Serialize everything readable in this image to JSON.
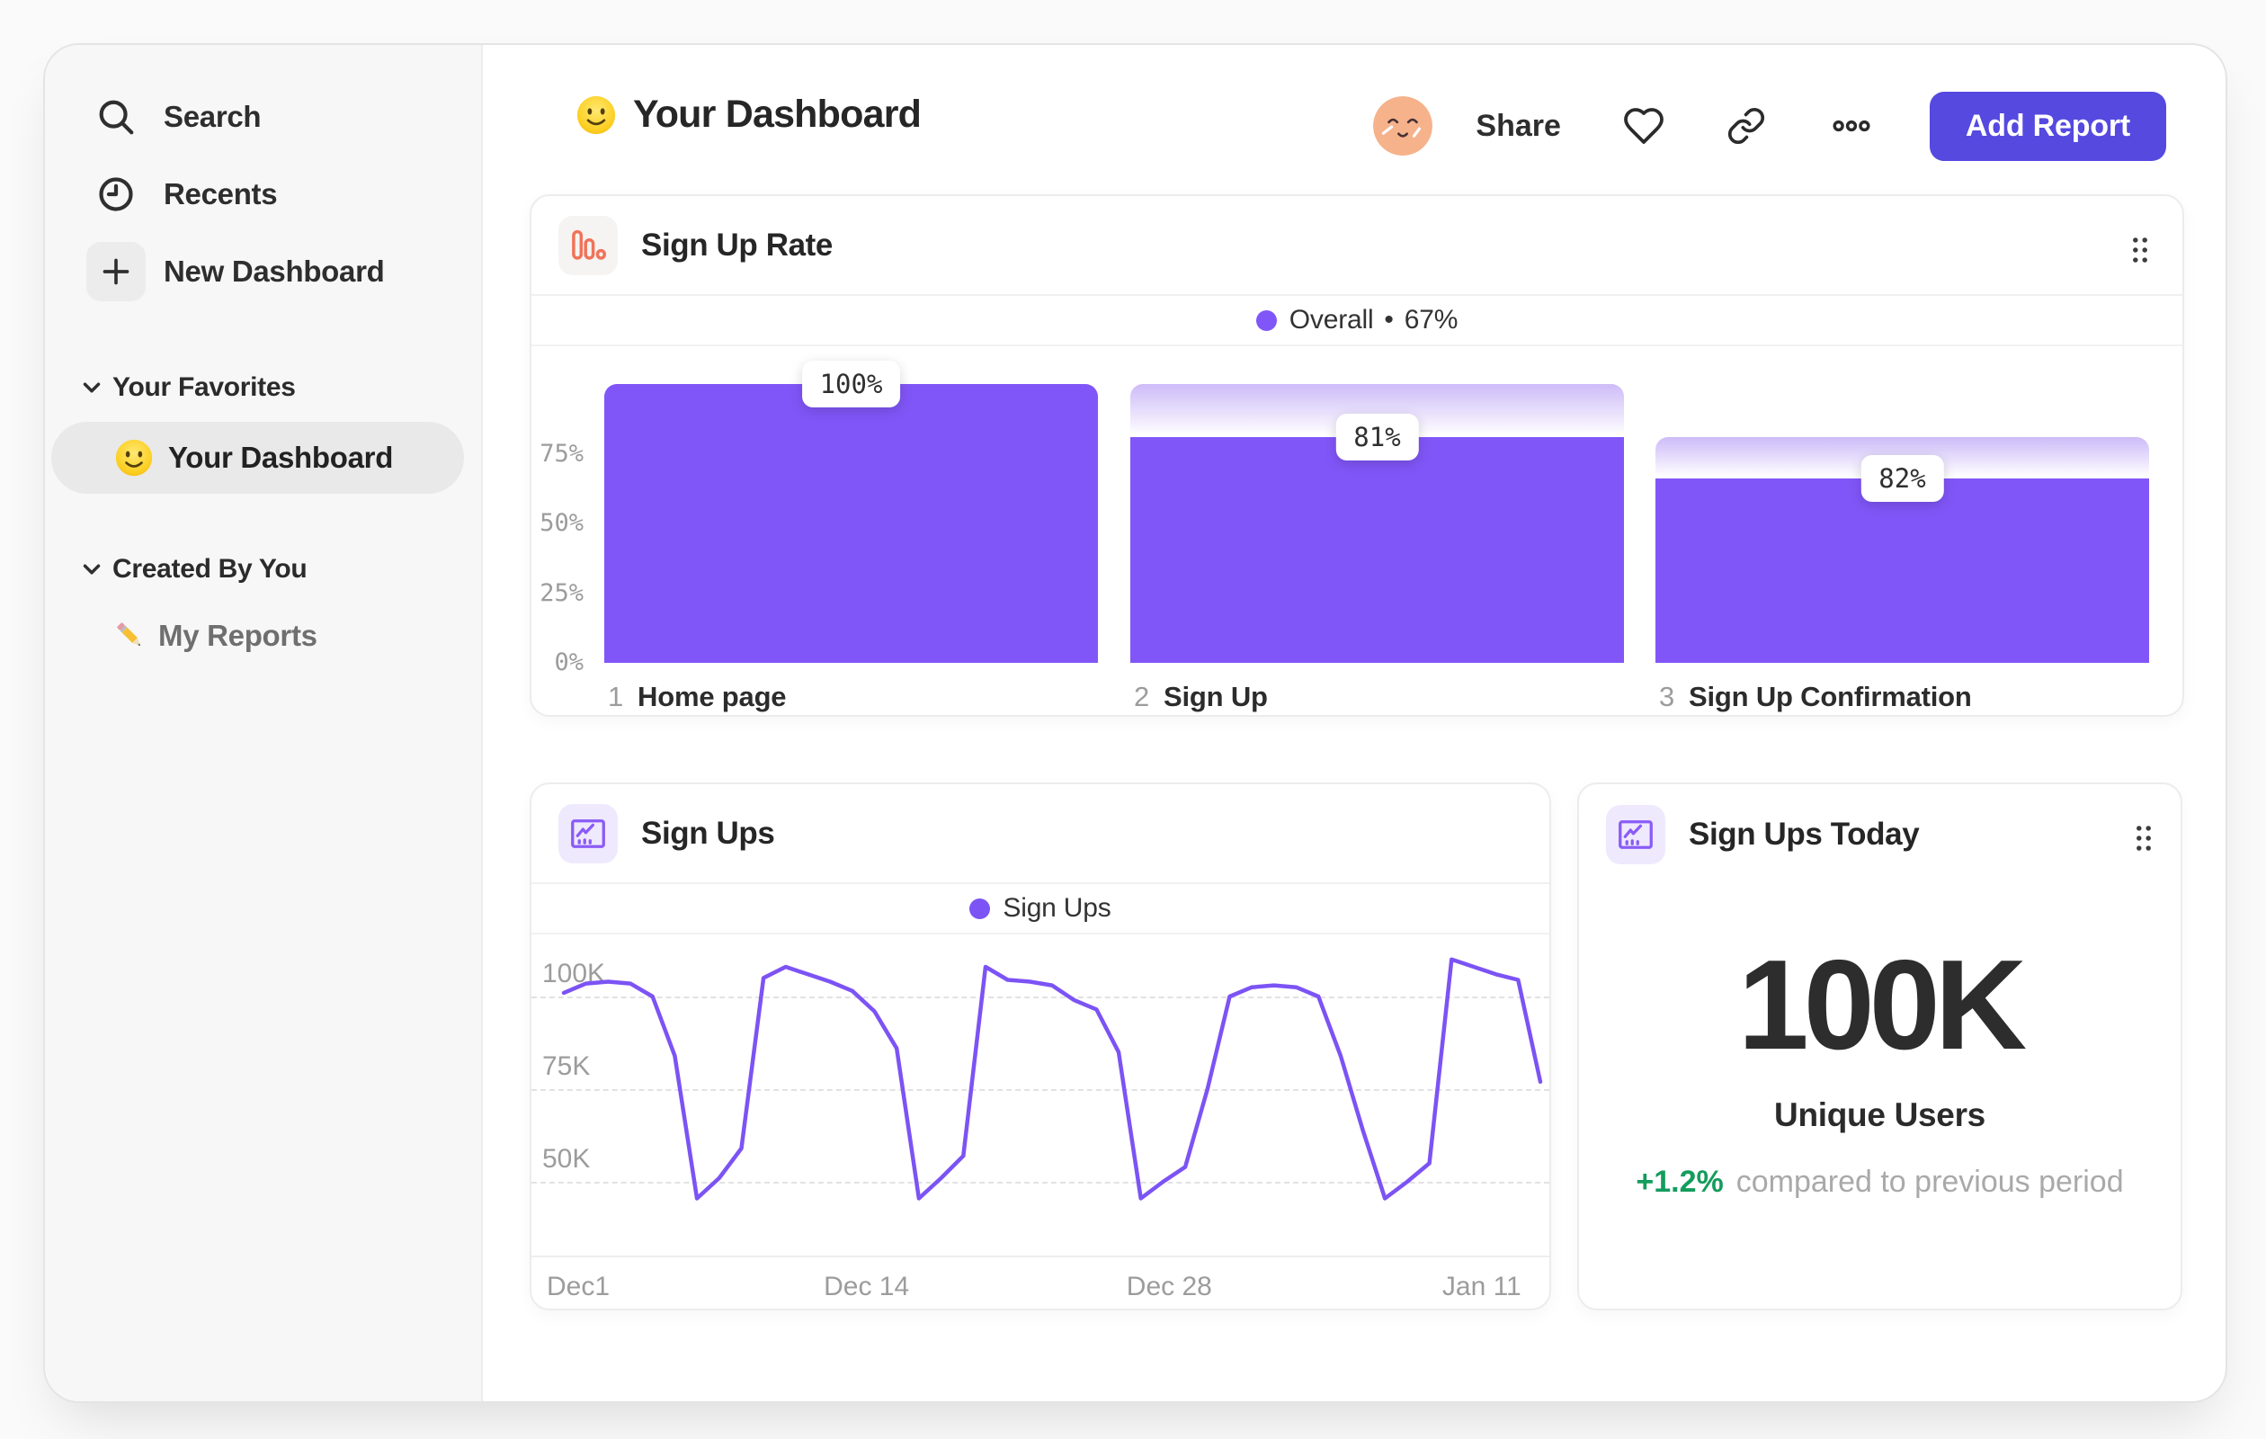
{
  "sidebar": {
    "nav": [
      {
        "label": "Search",
        "icon": "search"
      },
      {
        "label": "Recents",
        "icon": "clock"
      },
      {
        "label": "New Dashboard",
        "icon": "plus"
      }
    ],
    "sections": [
      {
        "label": "Your Favorites",
        "items": [
          {
            "label": "Your Dashboard",
            "emoji": "slightly-smiling-face",
            "active": true
          }
        ]
      },
      {
        "label": "Created By You",
        "items": [
          {
            "label": "My Reports",
            "emoji": "pencil",
            "active": false
          }
        ]
      }
    ]
  },
  "header": {
    "emoji": "slightly-smiling-face",
    "title": "Your Dashboard",
    "share_label": "Share",
    "add_report_label": "Add Report",
    "accent_color": "#5549e0"
  },
  "chart_data": [
    {
      "type": "bar",
      "variant": "funnel",
      "title": "Sign Up Rate",
      "legend": {
        "label": "Overall",
        "separator": "•",
        "value": "67%"
      },
      "categories": [
        "Home page",
        "Sign Up",
        "Sign Up Confirmation"
      ],
      "step_numbers": [
        "1",
        "2",
        "3"
      ],
      "step_conversion_pct": [
        100,
        81,
        82
      ],
      "overall_pct": [
        100,
        81,
        66
      ],
      "y_ticks": [
        0,
        25,
        50,
        75
      ],
      "ylim": [
        0,
        100
      ],
      "bar_color": "#8156f8",
      "grid": false,
      "legend_position": "top-center"
    },
    {
      "type": "line",
      "title": "Sign Ups",
      "legend": {
        "label": "Sign Ups"
      },
      "unit": "K",
      "values": [
        101,
        103.5,
        104,
        103.5,
        100,
        84,
        45.5,
        51,
        59,
        105,
        108,
        106,
        104,
        101.5,
        96,
        86,
        45.5,
        51,
        57,
        108,
        104.5,
        104,
        103,
        99,
        96.5,
        85,
        45.5,
        50,
        54,
        75,
        100,
        102.5,
        103,
        102.5,
        100,
        84,
        64,
        45.5,
        50,
        55,
        110,
        108,
        106,
        104.5,
        77
      ],
      "y_ticks": [
        {
          "label": "50K",
          "value": 50
        },
        {
          "label": "75K",
          "value": 75
        },
        {
          "label": "100K",
          "value": 100
        }
      ],
      "x_ticks": [
        {
          "label": "Dec1",
          "f": 0
        },
        {
          "label": "Dec 14",
          "f": 0.31
        },
        {
          "label": "Dec 28",
          "f": 0.62
        },
        {
          "label": "Jan 11",
          "f": 0.94
        }
      ],
      "ylim": [
        40,
        115
      ],
      "line_color": "#7c53f4",
      "grid": "dashed-horizontal",
      "legend_position": "top-center"
    },
    {
      "type": "stat",
      "title": "Sign Ups Today",
      "value": "100K",
      "label": "Unique Users",
      "delta": "+1.2%",
      "delta_color": "#149c5d",
      "comparison": "compared to previous period"
    }
  ]
}
